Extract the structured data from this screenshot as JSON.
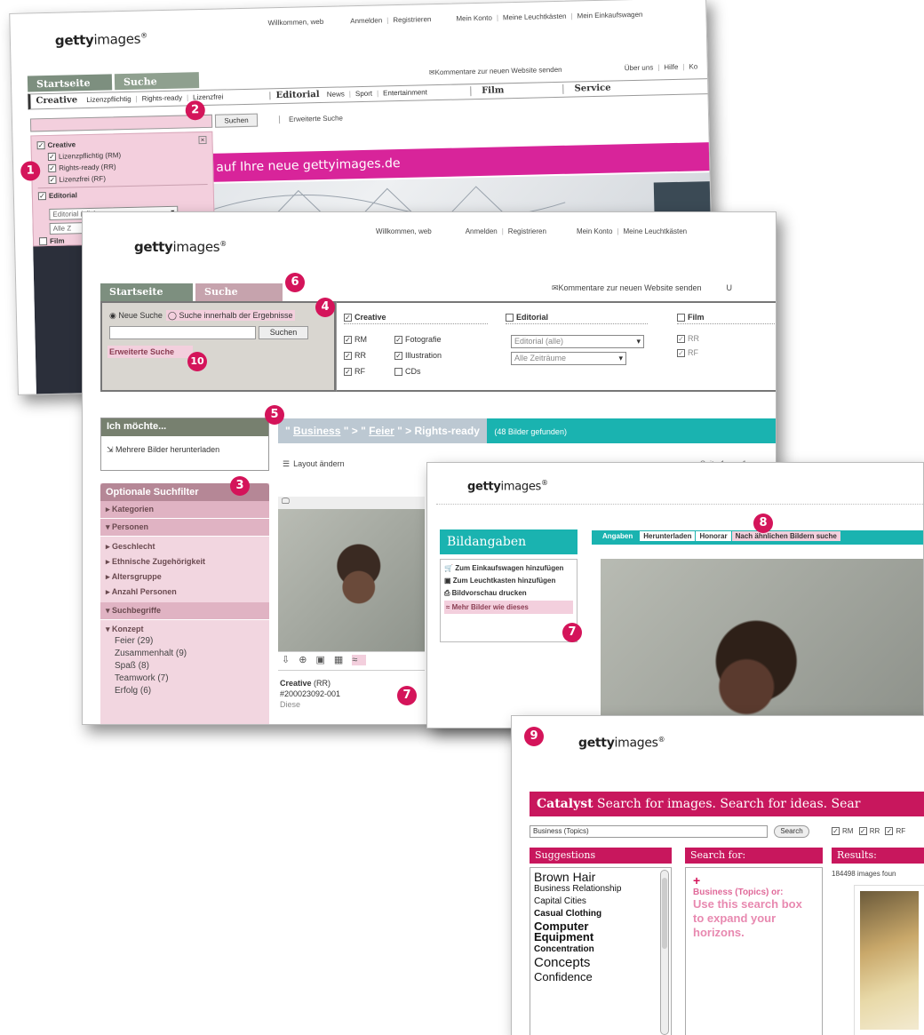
{
  "logo": {
    "bold": "getty",
    "rest": "images",
    "reg": "®"
  },
  "s1": {
    "nav": [
      "Willkommen, web",
      "Anmelden",
      "Registrieren",
      "Mein Konto",
      "Meine Leuchtkästen",
      "Mein Einkaufswagen"
    ],
    "tabs": [
      "Startseite",
      "Suche"
    ],
    "feedback": "Kommentare zur neuen Website senden",
    "links": [
      "Über uns",
      "Hilfe",
      "Ko"
    ],
    "cat_creative": "Creative",
    "cat_creative_links": [
      "Lizenzpflichtig",
      "Rights-ready",
      "Lizenzfrei"
    ],
    "cat_editorial": "Editorial",
    "cat_editorial_links": [
      "News",
      "Sport",
      "Entertainment"
    ],
    "cat_film": "Film",
    "cat_service": "Service",
    "search_btn": "Suchen",
    "adv_search": "Erweiterte Suche",
    "dd_creative": "Creative",
    "dd_items": [
      "Lizenzpflichtig (RM)",
      "Rights-ready (RR)",
      "Lizenzfrei (RF)"
    ],
    "dd_editorial": "Editorial",
    "dd_editorial_select": "Editorial (alle)",
    "dd_alle": "Alle Z",
    "dd_film": "Film",
    "banner": "auf Ihre neue gettyimages.de"
  },
  "s2": {
    "nav": [
      "Willkommen, web",
      "Anmelden",
      "Registrieren",
      "Mein Konto",
      "Meine Leuchtkästen"
    ],
    "tabs": [
      "Startseite",
      "Suche"
    ],
    "feedback": "Kommentare zur neuen Website senden",
    "feedback_tail": "U",
    "radio_new": "Neue Suche",
    "radio_within": "Suche innerhalb der Ergebnisse",
    "search_btn": "Suchen",
    "adv_search": "Erweiterte Suche",
    "creative": "Creative",
    "creative_opts": [
      "RM",
      "RR",
      "RF"
    ],
    "creative_opts2": [
      "Fotografie",
      "Illustration",
      "CDs"
    ],
    "editorial": "Editorial",
    "editorial_select": "Editorial (alle)",
    "zeit_select": "Alle Zeiträume",
    "film": "Film",
    "film_opts": [
      "RR",
      "RF"
    ],
    "ich_moechte": "Ich möchte...",
    "download_multi": "Mehrere Bilder herunterladen",
    "crumb_q1": "Business",
    "crumb_q2": "Feier",
    "crumb_rr": "Rights-ready",
    "crumb_count": "(48 Bilder gefunden)",
    "layout": "Layout ändern",
    "seite": "Seite 1 von 1",
    "filters_title": "Optionale Suchfilter",
    "f_kategorien": "Kategorien",
    "f_personen": "Personen",
    "f_personen_items": [
      "Geschlecht",
      "Ethnische Zugehörigkeit",
      "Altersgruppe",
      "Anzahl Personen"
    ],
    "f_suchbegriffe": "Suchbegriffe",
    "f_konzept": "Konzept",
    "f_konzept_items": [
      "Feier (29)",
      "Zusammenhalt (9)",
      "Spaß (8)",
      "Teamwork (7)",
      "Erfolg (6)"
    ],
    "img_title": "Creative",
    "img_rr": "(RR)",
    "img_id": "#200023092-001",
    "img_more": "Diese"
  },
  "s3": {
    "title": "Bildangaben",
    "actions": [
      "Zum Einkaufswagen hinzufügen",
      "Zum Leuchtkasten hinzufügen",
      "Bildvorschau drucken",
      "Mehr Bilder wie dieses"
    ],
    "tabs": [
      "Angaben",
      "Herunterladen",
      "Honorar",
      "Nach ähnlichen Bildern suche"
    ]
  },
  "s4": {
    "catalyst": "Catalyst",
    "tagline": "Search for images. Search for ideas. Sear",
    "search_value": "Business (Topics)",
    "search_btn": "Search",
    "checks": [
      "RM",
      "RR",
      "RF"
    ],
    "suggestions": "Suggestions",
    "search_for": "Search for:",
    "results": "Results:",
    "results_count": "184498 images foun",
    "sugg_items": [
      "Brown Hair",
      "Business Relationship",
      "Capital Cities",
      "Casual Clothing",
      "Computer Equipment",
      "Concentration",
      "Concepts",
      "Confidence"
    ],
    "plus": "+",
    "searchfor_q": "Business (Topics) or:",
    "searchfor_hint": "Use this search box to expand your horizons."
  },
  "badges": [
    "1",
    "2",
    "3",
    "4",
    "5",
    "6",
    "7",
    "8",
    "7",
    "9",
    "10"
  ],
  "colors": {
    "accent": "#d4145a",
    "teal": "#1ab3b0",
    "tab_green": "#7d8f7f",
    "pink_panel": "#f3cfdd",
    "banner": "#d8249a"
  }
}
